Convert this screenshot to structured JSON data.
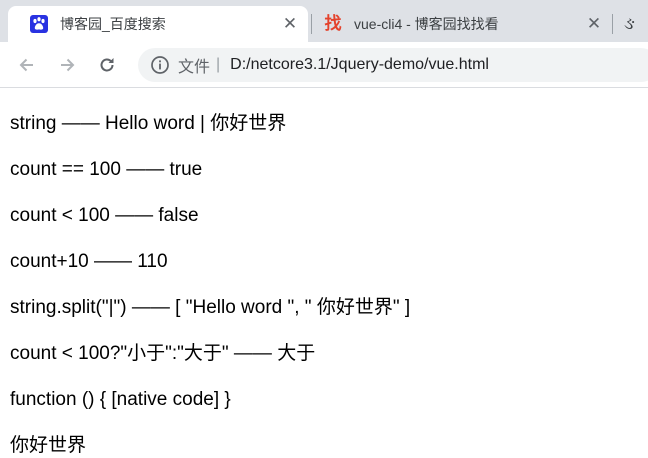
{
  "browser": {
    "tabs": [
      {
        "title": "博客园_百度搜索",
        "favicon": "baidu-paw-icon",
        "close": "✕"
      },
      {
        "title": "vue-cli4 - 博客园找找看",
        "favicon": "zhao-search-icon",
        "favicon_text": "找",
        "close": "✕"
      }
    ],
    "tab_overflow_glyph": "ઙ",
    "address_bar": {
      "security_label": "文件",
      "separator": "|",
      "url": "D:/netcore3.1/Jquery-demo/vue.html"
    }
  },
  "page": {
    "lines": [
      "string —— Hello word | 你好世界",
      "count == 100 —— true",
      "count < 100 —— false",
      "count+10 —— 110",
      "string.split(\"|\") —— [ \"Hello word \", \" 你好世界\" ]",
      "count < 100?\"小于\":\"大于\" —— 大于",
      "function () { [native code] }",
      "你好世界"
    ]
  },
  "colors": {
    "tabstrip_bg": "#dee1e6",
    "omnibox_bg": "#f1f3f4",
    "baidu_blue": "#2932e1",
    "zhao_red": "#e4432d"
  }
}
